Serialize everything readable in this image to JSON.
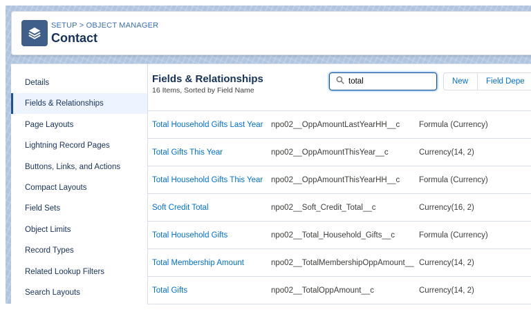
{
  "header": {
    "breadcrumb_setup": "SETUP",
    "breadcrumb_sep": ">",
    "breadcrumb_object_manager": "OBJECT MANAGER",
    "title": "Contact",
    "icon": "layers-icon"
  },
  "sidebar": {
    "items": [
      {
        "label": "Details",
        "active": false
      },
      {
        "label": "Fields & Relationships",
        "active": true
      },
      {
        "label": "Page Layouts",
        "active": false
      },
      {
        "label": "Lightning Record Pages",
        "active": false
      },
      {
        "label": "Buttons, Links, and Actions",
        "active": false
      },
      {
        "label": "Compact Layouts",
        "active": false
      },
      {
        "label": "Field Sets",
        "active": false
      },
      {
        "label": "Object Limits",
        "active": false
      },
      {
        "label": "Record Types",
        "active": false
      },
      {
        "label": "Related Lookup Filters",
        "active": false
      },
      {
        "label": "Search Layouts",
        "active": false
      }
    ]
  },
  "main": {
    "title": "Fields & Relationships",
    "subtitle": "16 Items, Sorted by Field Name",
    "search": {
      "value": "total",
      "icon": "search-icon"
    },
    "new_button": "New",
    "dependencies_button": "Field Depe",
    "rows": [
      {
        "label": "Total Household Gifts Last Year",
        "api": "npo02__OppAmountLastYearHH__c",
        "type": "Formula (Currency)"
      },
      {
        "label": "Total Gifts This Year",
        "api": "npo02__OppAmountThisYear__c",
        "type": "Currency(14, 2)"
      },
      {
        "label": "Total Household Gifts This Year",
        "api": "npo02__OppAmountThisYearHH__c",
        "type": "Formula (Currency)"
      },
      {
        "label": "Soft Credit Total",
        "api": "npo02__Soft_Credit_Total__c",
        "type": "Currency(16, 2)"
      },
      {
        "label": "Total Household Gifts",
        "api": "npo02__Total_Household_Gifts__c",
        "type": "Formula (Currency)"
      },
      {
        "label": "Total Membership Amount",
        "api": "npo02__TotalMembershipOppAmount__",
        "type": "Currency(14, 2)"
      },
      {
        "label": "Total Gifts",
        "api": "npo02__TotalOppAmount__c",
        "type": "Currency(14, 2)"
      }
    ]
  },
  "colors": {
    "brand": "#16325c",
    "link": "#0070d2",
    "icon_bg": "#3f5f8a",
    "active_border": "#1b5297"
  }
}
